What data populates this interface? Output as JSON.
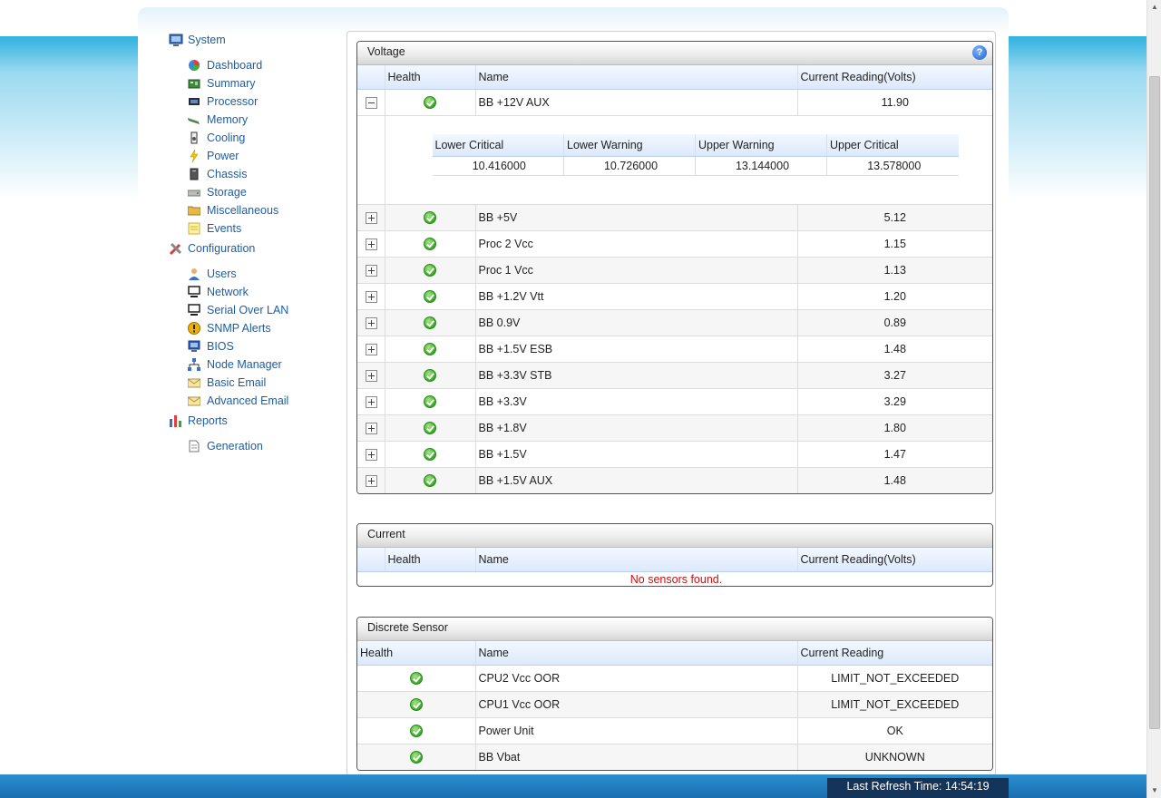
{
  "sidebar": {
    "groups": [
      {
        "label": "System",
        "icon": "system-monitor-icon",
        "items": [
          {
            "label": "Dashboard",
            "icon": "dashboard-pie-icon"
          },
          {
            "label": "Summary",
            "icon": "summary-board-icon"
          },
          {
            "label": "Processor",
            "icon": "processor-chip-icon"
          },
          {
            "label": "Memory",
            "icon": "memory-stick-icon"
          },
          {
            "label": "Cooling",
            "icon": "cooling-fan-icon"
          },
          {
            "label": "Power",
            "icon": "power-bolt-icon"
          },
          {
            "label": "Chassis",
            "icon": "chassis-tower-icon"
          },
          {
            "label": "Storage",
            "icon": "storage-drive-icon"
          },
          {
            "label": "Miscellaneous",
            "icon": "folder-icon"
          },
          {
            "label": "Events",
            "icon": "events-log-icon"
          }
        ]
      },
      {
        "label": "Configuration",
        "icon": "tools-icon",
        "items": [
          {
            "label": "Users",
            "icon": "user-icon"
          },
          {
            "label": "Network",
            "icon": "network-computer-icon"
          },
          {
            "label": "Serial Over LAN",
            "icon": "serial-lan-icon"
          },
          {
            "label": "SNMP Alerts",
            "icon": "alert-icon"
          },
          {
            "label": "BIOS",
            "icon": "bios-monitor-icon"
          },
          {
            "label": "Node Manager",
            "icon": "node-tree-icon"
          },
          {
            "label": "Basic Email",
            "icon": "email-envelope-icon"
          },
          {
            "label": "Advanced Email",
            "icon": "email-advanced-icon"
          }
        ]
      },
      {
        "label": "Reports",
        "icon": "reports-chart-icon",
        "items": [
          {
            "label": "Generation",
            "icon": "document-icon"
          }
        ]
      }
    ]
  },
  "voltage": {
    "title": "Voltage",
    "headers": {
      "health": "Health",
      "name": "Name",
      "reading": "Current Reading(Volts)"
    },
    "expanded": {
      "name": "BB +12V AUX",
      "reading": "11.90",
      "thresholds": {
        "headers": [
          "Lower Critical",
          "Lower Warning",
          "Upper Warning",
          "Upper Critical"
        ],
        "values": [
          "10.416000",
          "10.726000",
          "13.144000",
          "13.578000"
        ]
      }
    },
    "rows": [
      {
        "name": "BB +5V",
        "reading": "5.12"
      },
      {
        "name": "Proc 2 Vcc",
        "reading": "1.15"
      },
      {
        "name": "Proc 1 Vcc",
        "reading": "1.13"
      },
      {
        "name": "BB +1.2V Vtt",
        "reading": "1.20"
      },
      {
        "name": "BB 0.9V",
        "reading": "0.89"
      },
      {
        "name": "BB +1.5V ESB",
        "reading": "1.48"
      },
      {
        "name": "BB +3.3V STB",
        "reading": "3.27"
      },
      {
        "name": "BB +3.3V",
        "reading": "3.29"
      },
      {
        "name": "BB +1.8V",
        "reading": "1.80"
      },
      {
        "name": "BB +1.5V",
        "reading": "1.47"
      },
      {
        "name": "BB +1.5V AUX",
        "reading": "1.48"
      }
    ]
  },
  "current": {
    "title": "Current",
    "headers": {
      "health": "Health",
      "name": "Name",
      "reading": "Current Reading(Volts)"
    },
    "empty_message": "No sensors found."
  },
  "discrete": {
    "title": "Discrete Sensor",
    "headers": {
      "health": "Health",
      "name": "Name",
      "reading": "Current Reading"
    },
    "rows": [
      {
        "name": "CPU2 Vcc OOR",
        "reading": "LIMIT_NOT_EXCEEDED"
      },
      {
        "name": "CPU1 Vcc OOR",
        "reading": "LIMIT_NOT_EXCEEDED"
      },
      {
        "name": "Power Unit",
        "reading": "OK"
      },
      {
        "name": "BB Vbat",
        "reading": "UNKNOWN"
      }
    ]
  },
  "footer": {
    "refresh_text": "Last Refresh Time: 14:54:19"
  },
  "help": {
    "label": "?"
  },
  "colors": {
    "link": "#1a5ea8",
    "error": "#cc1111",
    "bottom_bar": "#1a6eb0"
  }
}
